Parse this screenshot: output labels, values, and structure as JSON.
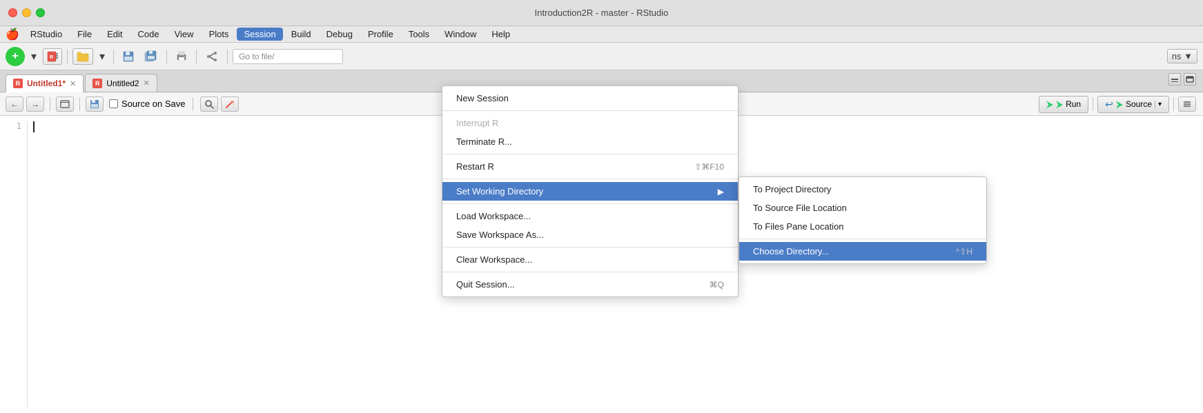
{
  "titleBar": {
    "title": "Introduction2R - master - RStudio",
    "appName": "RStudio"
  },
  "menuBar": {
    "apple": "🍎",
    "items": [
      {
        "id": "rstudio",
        "label": "RStudio"
      },
      {
        "id": "file",
        "label": "File"
      },
      {
        "id": "edit",
        "label": "Edit"
      },
      {
        "id": "code",
        "label": "Code"
      },
      {
        "id": "view",
        "label": "View"
      },
      {
        "id": "plots",
        "label": "Plots"
      },
      {
        "id": "session",
        "label": "Session",
        "active": true
      },
      {
        "id": "build",
        "label": "Build"
      },
      {
        "id": "debug",
        "label": "Debug"
      },
      {
        "id": "profile",
        "label": "Profile"
      },
      {
        "id": "tools",
        "label": "Tools"
      },
      {
        "id": "window",
        "label": "Window"
      },
      {
        "id": "help",
        "label": "Help"
      }
    ]
  },
  "toolbar": {
    "newFile": "+",
    "goToPlaceholder": "Go to file/",
    "onsLabel": "ns ▼"
  },
  "editorTabs": {
    "tabs": [
      {
        "id": "untitled1",
        "label": "Untitled1",
        "modified": true,
        "active": true
      },
      {
        "id": "untitled2",
        "label": "Untitled2",
        "modified": false,
        "active": false
      }
    ]
  },
  "editorToolbar": {
    "sourceOnSave": "Source on Save",
    "run": "Run",
    "source": "Source"
  },
  "editor": {
    "lineNumber": "1"
  },
  "sessionMenu": {
    "items": [
      {
        "id": "new-session",
        "label": "New Session",
        "shortcut": "",
        "disabled": false,
        "highlighted": false,
        "hasSubmenu": false
      },
      {
        "id": "sep1",
        "separator": true
      },
      {
        "id": "interrupt-r",
        "label": "Interrupt R",
        "shortcut": "",
        "disabled": true,
        "highlighted": false,
        "hasSubmenu": false
      },
      {
        "id": "terminate-r",
        "label": "Terminate R...",
        "shortcut": "",
        "disabled": false,
        "highlighted": false,
        "hasSubmenu": false
      },
      {
        "id": "sep2",
        "separator": true
      },
      {
        "id": "restart-r",
        "label": "Restart R",
        "shortcut": "⇧⌘F10",
        "disabled": false,
        "highlighted": false,
        "hasSubmenu": false
      },
      {
        "id": "sep3",
        "separator": true
      },
      {
        "id": "set-working-dir",
        "label": "Set Working Directory",
        "shortcut": "",
        "disabled": false,
        "highlighted": true,
        "hasSubmenu": true
      },
      {
        "id": "sep4",
        "separator": true
      },
      {
        "id": "load-workspace",
        "label": "Load Workspace...",
        "shortcut": "",
        "disabled": false,
        "highlighted": false,
        "hasSubmenu": false
      },
      {
        "id": "save-workspace",
        "label": "Save Workspace As...",
        "shortcut": "",
        "disabled": false,
        "highlighted": false,
        "hasSubmenu": false
      },
      {
        "id": "sep5",
        "separator": true
      },
      {
        "id": "clear-workspace",
        "label": "Clear Workspace...",
        "shortcut": "",
        "disabled": false,
        "highlighted": false,
        "hasSubmenu": false
      },
      {
        "id": "sep6",
        "separator": true
      },
      {
        "id": "quit-session",
        "label": "Quit Session...",
        "shortcut": "⌘Q",
        "disabled": false,
        "highlighted": false,
        "hasSubmenu": false
      }
    ]
  },
  "submenu": {
    "items": [
      {
        "id": "to-project-dir",
        "label": "To Project Directory",
        "shortcut": "",
        "highlighted": false
      },
      {
        "id": "to-source-file",
        "label": "To Source File Location",
        "shortcut": "",
        "highlighted": false
      },
      {
        "id": "to-files-pane",
        "label": "To Files Pane Location",
        "shortcut": "",
        "highlighted": false
      },
      {
        "id": "sep",
        "separator": true
      },
      {
        "id": "choose-dir",
        "label": "Choose Directory...",
        "shortcut": "^⇧H",
        "highlighted": true
      }
    ]
  }
}
